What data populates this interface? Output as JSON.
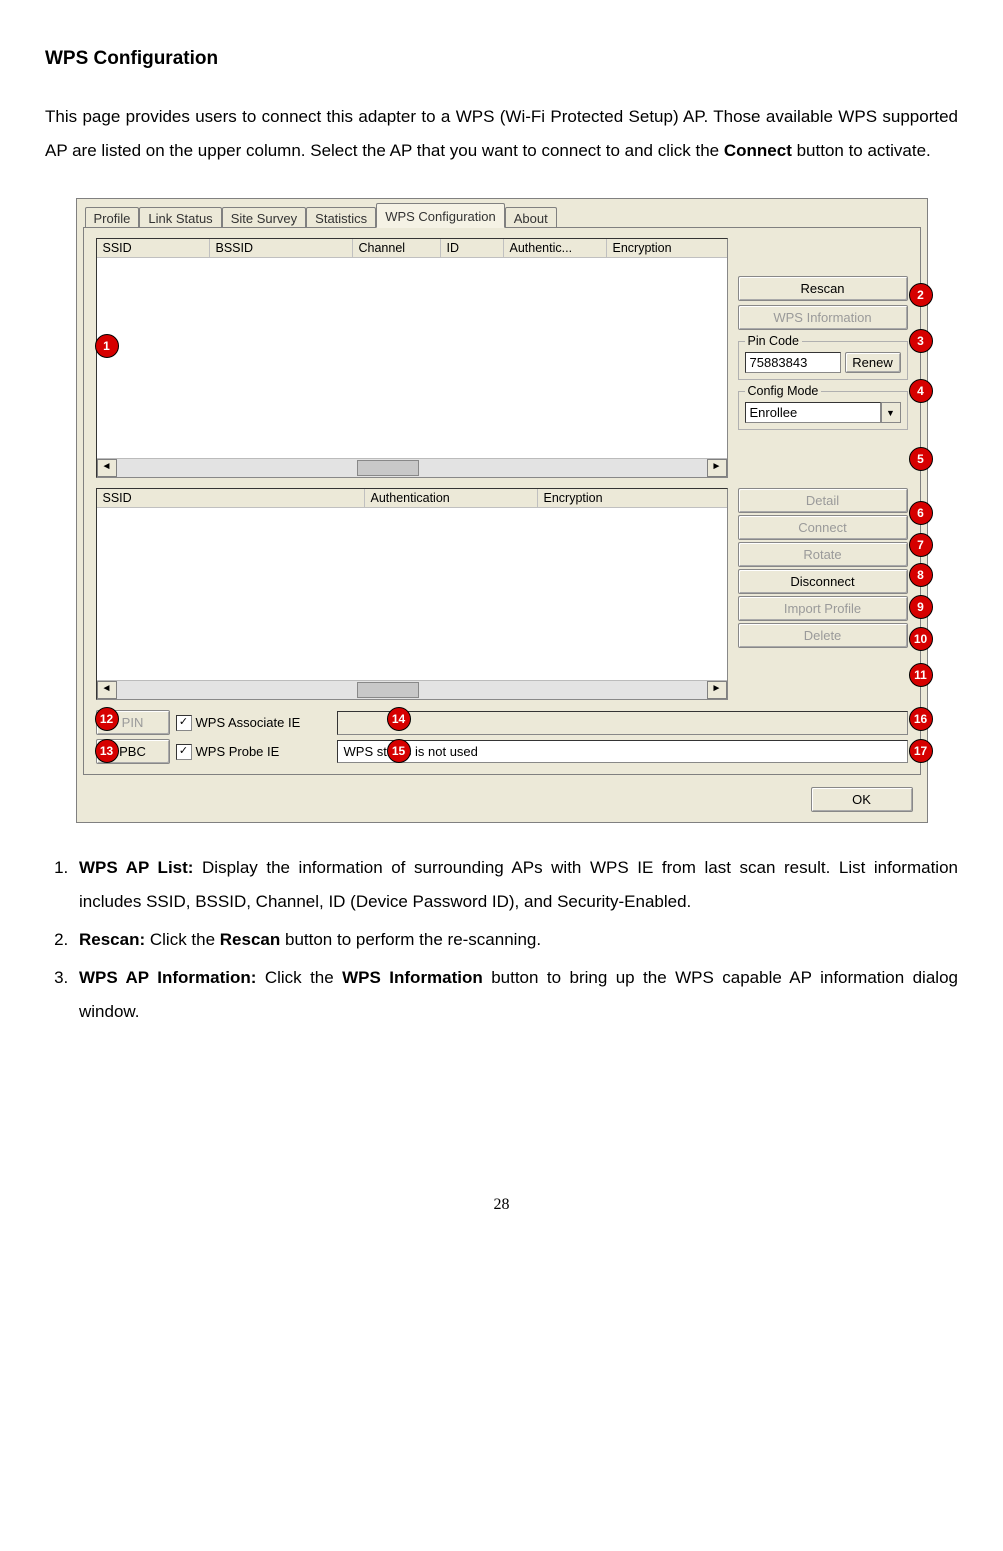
{
  "title": "WPS Configuration",
  "intro_before_bold": "This page provides users to connect this adapter to a WPS (Wi-Fi Protected Setup) AP. Those available WPS supported AP are listed on the upper column. Select the AP that you want to connect to and click the ",
  "intro_bold": "Connect",
  "intro_after_bold": " button to activate.",
  "tabs": {
    "profile": "Profile",
    "link_status": "Link Status",
    "site_survey": "Site Survey",
    "statistics": "Statistics",
    "wps": "WPS Configuration",
    "about": "About"
  },
  "upper_list_cols": {
    "ssid": "SSID",
    "bssid": "BSSID",
    "channel": "Channel",
    "id": "ID",
    "authentic": "Authentic...",
    "encryption": "Encryption"
  },
  "buttons": {
    "rescan": "Rescan",
    "wps_info": "WPS Information",
    "renew": "Renew",
    "detail": "Detail",
    "connect": "Connect",
    "rotate": "Rotate",
    "disconnect": "Disconnect",
    "import_profile": "Import Profile",
    "delete": "Delete",
    "pin": "PIN",
    "pbc": "PBC",
    "ok": "OK"
  },
  "groups": {
    "pin_code": "Pin Code",
    "config_mode": "Config Mode"
  },
  "pin_value": "75883843",
  "config_mode_value": "Enrollee",
  "lower_list_cols": {
    "ssid": "SSID",
    "authentication": "Authentication",
    "encryption": "Encryption"
  },
  "checks": {
    "wps_assoc": "WPS Associate IE",
    "wps_probe": "WPS Probe IE"
  },
  "status_text": "WPS status is not used",
  "callouts": {
    "c1": "1",
    "c2": "2",
    "c3": "3",
    "c4": "4",
    "c5": "5",
    "c6": "6",
    "c7": "7",
    "c8": "8",
    "c9": "9",
    "c10": "10",
    "c11": "11",
    "c12": "12",
    "c13": "13",
    "c14": "14",
    "c15": "15",
    "c16": "16",
    "c17": "17"
  },
  "list_items": {
    "i1_lead": "WPS AP List:",
    "i1_rest": " Display the information of surrounding APs with WPS IE from last scan result. List information includes SSID, BSSID, Channel, ID (Device Password ID), and Security-Enabled.",
    "i2_lead": "Rescan:",
    "i2_mid": " Click the ",
    "i2_bold": "Rescan",
    "i2_rest": " button to perform the re-scanning.",
    "i3_lead": "WPS AP Information:",
    "i3_mid": " Click the ",
    "i3_bold": "WPS Information",
    "i3_rest": " button to bring up the WPS capable AP information dialog window."
  },
  "page_number": "28"
}
